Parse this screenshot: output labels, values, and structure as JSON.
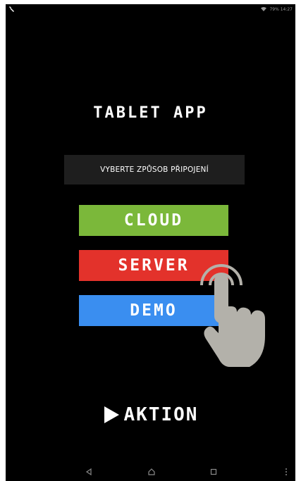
{
  "status_bar": {
    "left_icon": "wrench-icon",
    "right_text": "79% 14:27"
  },
  "app": {
    "title": "TABLET APP",
    "connection_prompt": "VYBERTE ZPŮSOB PŘIPOJENÍ"
  },
  "buttons": {
    "cloud_label": "CLOUD",
    "server_label": "SERVER",
    "demo_label": "DEMO"
  },
  "brand": {
    "name": "AKTION",
    "icon": "play-triangle-icon"
  },
  "nav_bar": {
    "icons": [
      "back-icon",
      "home-icon",
      "recents-icon",
      "menu-icon"
    ]
  },
  "colors": {
    "cloud": "#7bb83a",
    "server": "#e3322b",
    "demo": "#3a8ef0",
    "background": "#000000",
    "prompt_box": "#1e1e1e",
    "hand": "#b3b1aa"
  }
}
